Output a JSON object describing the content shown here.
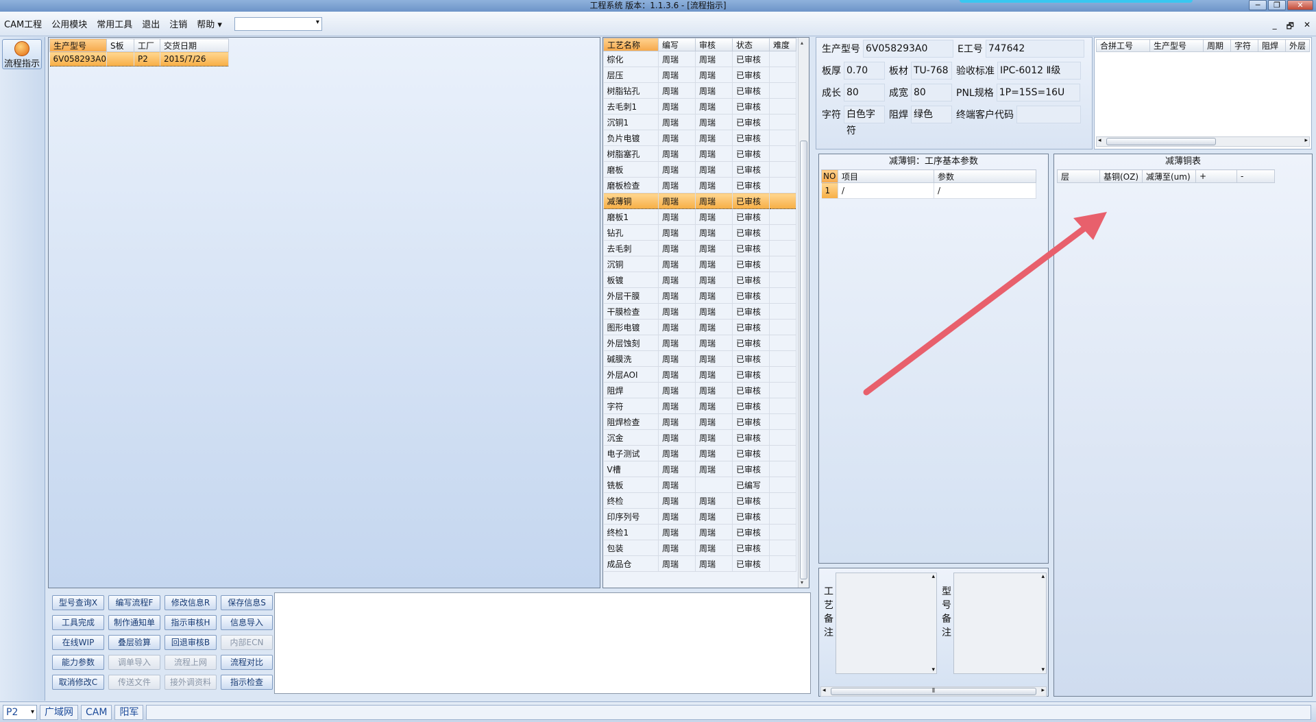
{
  "window": {
    "title": "工程系统   版本：1.1.3.6 - [流程指示]",
    "controls": [
      "─",
      "❐",
      "✕"
    ]
  },
  "menu": {
    "items": [
      "CAM工程",
      "公用模块",
      "常用工具",
      "退出",
      "注销",
      "帮助"
    ],
    "help_arrow": "▾",
    "combo_value": "",
    "mdi_controls": [
      "_",
      "🗗",
      "✕"
    ]
  },
  "sidebar": {
    "flow_button_label": "流程指示"
  },
  "order_list": {
    "columns": [
      "生产型号",
      "S板",
      "工厂",
      "交货日期"
    ],
    "rows": [
      [
        "6V058293A0",
        "",
        "P2",
        "2015/7/26"
      ]
    ]
  },
  "process_list": {
    "columns": [
      "工艺名称",
      "编写",
      "审核",
      "状态",
      "难度"
    ],
    "rows": [
      [
        "棕化",
        "周瑞",
        "周瑞",
        "已审核",
        ""
      ],
      [
        "层压",
        "周瑞",
        "周瑞",
        "已审核",
        ""
      ],
      [
        "树脂钻孔",
        "周瑞",
        "周瑞",
        "已审核",
        ""
      ],
      [
        "去毛刺1",
        "周瑞",
        "周瑞",
        "已审核",
        ""
      ],
      [
        "沉铜1",
        "周瑞",
        "周瑞",
        "已审核",
        ""
      ],
      [
        "负片电镀",
        "周瑞",
        "周瑞",
        "已审核",
        ""
      ],
      [
        "树脂塞孔",
        "周瑞",
        "周瑞",
        "已审核",
        ""
      ],
      [
        "磨板",
        "周瑞",
        "周瑞",
        "已审核",
        ""
      ],
      [
        "磨板检查",
        "周瑞",
        "周瑞",
        "已审核",
        ""
      ],
      [
        "减薄铜",
        "周瑞",
        "周瑞",
        "已审核",
        ""
      ],
      [
        "磨板1",
        "周瑞",
        "周瑞",
        "已审核",
        ""
      ],
      [
        "钻孔",
        "周瑞",
        "周瑞",
        "已审核",
        ""
      ],
      [
        "去毛刺",
        "周瑞",
        "周瑞",
        "已审核",
        ""
      ],
      [
        "沉铜",
        "周瑞",
        "周瑞",
        "已审核",
        ""
      ],
      [
        "板镀",
        "周瑞",
        "周瑞",
        "已审核",
        ""
      ],
      [
        "外层干膜",
        "周瑞",
        "周瑞",
        "已审核",
        ""
      ],
      [
        "干膜检查",
        "周瑞",
        "周瑞",
        "已审核",
        ""
      ],
      [
        "图形电镀",
        "周瑞",
        "周瑞",
        "已审核",
        ""
      ],
      [
        "外层蚀刻",
        "周瑞",
        "周瑞",
        "已审核",
        ""
      ],
      [
        "碱膜洗",
        "周瑞",
        "周瑞",
        "已审核",
        ""
      ],
      [
        "外层AOI",
        "周瑞",
        "周瑞",
        "已审核",
        ""
      ],
      [
        "阻焊",
        "周瑞",
        "周瑞",
        "已审核",
        ""
      ],
      [
        "字符",
        "周瑞",
        "周瑞",
        "已审核",
        ""
      ],
      [
        "阻焊检查",
        "周瑞",
        "周瑞",
        "已审核",
        ""
      ],
      [
        "沉金",
        "周瑞",
        "周瑞",
        "已审核",
        ""
      ],
      [
        "电子测试",
        "周瑞",
        "周瑞",
        "已审核",
        ""
      ],
      [
        "V槽",
        "周瑞",
        "周瑞",
        "已审核",
        ""
      ],
      [
        "铣板",
        "周瑞",
        "",
        "已编写",
        ""
      ],
      [
        "终检",
        "周瑞",
        "周瑞",
        "已审核",
        ""
      ],
      [
        "印序列号",
        "周瑞",
        "周瑞",
        "已审核",
        ""
      ],
      [
        "终检1",
        "周瑞",
        "周瑞",
        "已审核",
        ""
      ],
      [
        "包装",
        "周瑞",
        "周瑞",
        "已审核",
        ""
      ],
      [
        "成品仓",
        "周瑞",
        "周瑞",
        "已审核",
        ""
      ]
    ],
    "selected_index": 9
  },
  "info": {
    "model_label": "生产型号",
    "model_value": "6V058293A0",
    "eng_no_label": "E工号",
    "eng_no_value": "747642",
    "thickness_label": "板厚",
    "thickness_value": "0.70",
    "material_label": "板材",
    "material_value": "TU-768",
    "acceptance_label": "验收标准",
    "acceptance_value": "IPC-6012 Ⅱ级",
    "length_label": "成长",
    "length_value": "80",
    "width_label": "成宽",
    "width_value": "80",
    "pnl_label": "PNL规格",
    "pnl_value": "1P=15S=16U",
    "legend_label": "字符",
    "legend_value": "白色字符",
    "mask_label": "阻焊",
    "mask_value": "绿色",
    "customer_code_label": "终端客户代码",
    "customer_code_value": ""
  },
  "merge_list": {
    "columns": [
      "合拼工号",
      "生产型号",
      "周期",
      "字符",
      "阻焊",
      "外层"
    ]
  },
  "params": {
    "title": "减薄铜：工序基本参数",
    "columns": [
      "NO",
      "项目",
      "参数"
    ],
    "rows": [
      [
        "1",
        "/",
        "/"
      ]
    ]
  },
  "copper_table": {
    "title": "减薄铜表",
    "columns": [
      "层",
      "基铜(OZ)",
      "减薄至(um)",
      "+",
      "-"
    ]
  },
  "notes": {
    "process_note_label": "工艺备注",
    "model_note_label": "型号备注",
    "hscroll_grip": "⦀"
  },
  "scroll_glyphs": {
    "left": "◂",
    "right": "▸",
    "up": "▴",
    "down": "▾",
    "grip": "⦀"
  },
  "buttons": [
    {
      "label": "型号查询X",
      "enabled": true
    },
    {
      "label": "编写流程F",
      "enabled": true
    },
    {
      "label": "修改信息R",
      "enabled": true
    },
    {
      "label": "保存信息S",
      "enabled": true
    },
    {
      "label": "工具完成",
      "enabled": true
    },
    {
      "label": "制作通知单",
      "enabled": true
    },
    {
      "label": "指示审核H",
      "enabled": true
    },
    {
      "label": "信息导入",
      "enabled": true
    },
    {
      "label": "在线WIP",
      "enabled": true
    },
    {
      "label": "叠层验算",
      "enabled": true
    },
    {
      "label": "回退审核B",
      "enabled": true
    },
    {
      "label": "内部ECN",
      "enabled": false
    },
    {
      "label": "能力参数",
      "enabled": true
    },
    {
      "label": "调单导入",
      "enabled": false
    },
    {
      "label": "流程上网",
      "enabled": false
    },
    {
      "label": "流程对比",
      "enabled": true
    },
    {
      "label": "取消修改C",
      "enabled": true
    },
    {
      "label": "传送文件",
      "enabled": false
    },
    {
      "label": "接外调资料",
      "enabled": false
    },
    {
      "label": "指示检查",
      "enabled": true
    }
  ],
  "status": {
    "factory": "P2",
    "segments": [
      "广域网",
      "CAM",
      "阳军"
    ]
  },
  "colors": {
    "selection": "#f7ae45",
    "annotation_arrow": "#e8606c",
    "link_blue": "#1c4b9a"
  }
}
